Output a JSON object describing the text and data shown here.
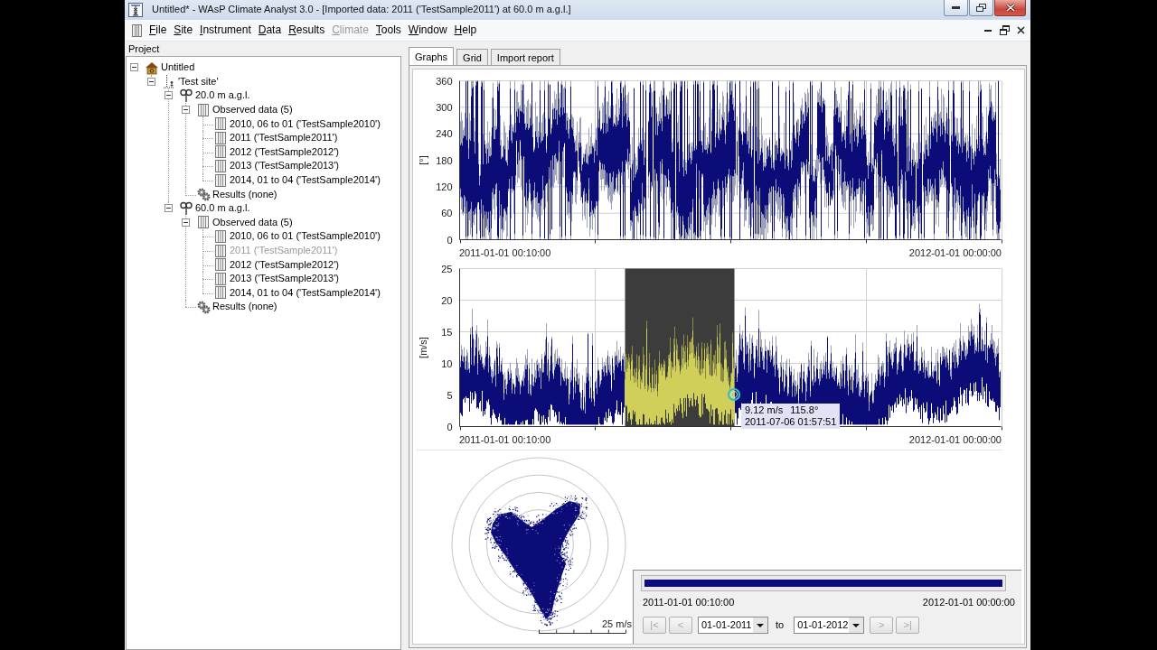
{
  "window": {
    "title": "Untitled* - WAsP Climate Analyst 3.0 - [Imported data: 2011 ('TestSample2011') at 60.0 m a.g.l.]"
  },
  "menu": [
    {
      "label": "File",
      "disabled": false
    },
    {
      "label": "Site",
      "disabled": false
    },
    {
      "label": "Instrument",
      "disabled": false
    },
    {
      "label": "Data",
      "disabled": false
    },
    {
      "label": "Results",
      "disabled": false
    },
    {
      "label": "Climate",
      "disabled": true
    },
    {
      "label": "Tools",
      "disabled": false
    },
    {
      "label": "Window",
      "disabled": false
    },
    {
      "label": "Help",
      "disabled": false
    }
  ],
  "project_pane": {
    "title": "Project",
    "tree": [
      {
        "label": "Untitled",
        "kind": "project",
        "expanded": true,
        "selected": false,
        "children": [
          {
            "label": "'Test site'",
            "kind": "site",
            "expanded": true,
            "selected": false,
            "children": [
              {
                "label": "20.0 m a.g.l.",
                "kind": "height",
                "expanded": true,
                "selected": false,
                "children": [
                  {
                    "label": "Observed data (5)",
                    "kind": "data_group",
                    "expanded": true,
                    "selected": false,
                    "children": [
                      {
                        "label": "2010, 06 to 01 ('TestSample2010')",
                        "kind": "dataset",
                        "selected": false
                      },
                      {
                        "label": "2011 ('TestSample2011')",
                        "kind": "dataset",
                        "selected": false
                      },
                      {
                        "label": "2012 ('TestSample2012')",
                        "kind": "dataset",
                        "selected": false
                      },
                      {
                        "label": "2013 ('TestSample2013')",
                        "kind": "dataset",
                        "selected": false
                      },
                      {
                        "label": "2014, 01 to 04 ('TestSample2014')",
                        "kind": "dataset",
                        "selected": false
                      }
                    ]
                  },
                  {
                    "label": "Results (none)",
                    "kind": "results",
                    "selected": false
                  }
                ]
              },
              {
                "label": "60.0 m a.g.l.",
                "kind": "height",
                "expanded": true,
                "selected": false,
                "children": [
                  {
                    "label": "Observed data (5)",
                    "kind": "data_group",
                    "expanded": true,
                    "selected": false,
                    "children": [
                      {
                        "label": "2010, 06 to 01 ('TestSample2010')",
                        "kind": "dataset",
                        "selected": false
                      },
                      {
                        "label": "2011 ('TestSample2011')",
                        "kind": "dataset",
                        "selected": true
                      },
                      {
                        "label": "2012 ('TestSample2012')",
                        "kind": "dataset",
                        "selected": false
                      },
                      {
                        "label": "2013 ('TestSample2013')",
                        "kind": "dataset",
                        "selected": false
                      },
                      {
                        "label": "2014, 01 to 04 ('TestSample2014')",
                        "kind": "dataset",
                        "selected": false
                      }
                    ]
                  },
                  {
                    "label": "Results (none)",
                    "kind": "results",
                    "selected": false
                  }
                ]
              }
            ]
          }
        ]
      }
    ]
  },
  "tabs": [
    {
      "label": "Graphs",
      "selected": true
    },
    {
      "label": "Grid",
      "selected": false
    },
    {
      "label": "Import report",
      "selected": false
    }
  ],
  "direction_graph": {
    "y_label": "[°]",
    "y_ticks": [
      "360",
      "300",
      "240",
      "180",
      "120",
      "60",
      "0"
    ],
    "x_start": "2011-01-01 00:10:00",
    "x_end": "2012-01-01 00:00:00"
  },
  "speed_graph": {
    "y_label": "[m/s]",
    "y_ticks": [
      "25",
      "20",
      "15",
      "10",
      "5",
      "0"
    ],
    "x_start": "2011-01-01 00:10:00",
    "x_end": "2012-01-01 00:00:00",
    "tooltip": {
      "speed": "9.12 m/s",
      "direction": "115.8°",
      "time": "2011-07-06 01:57:51"
    }
  },
  "wind_scatter": {
    "scale_label": "25 m/s"
  },
  "period_selector": {
    "level": 1,
    "start_label": "2011-01-01 00:10:00",
    "end_label": "2012-01-01 00:00:00",
    "controls": [
      {
        "kind": "button",
        "label": "|<",
        "disabled": true
      },
      {
        "kind": "button",
        "label": "<",
        "disabled": true
      },
      {
        "kind": "dropdown",
        "value": "01-01-2011",
        "disabled": false
      },
      {
        "kind": "text",
        "label": "to",
        "disabled": false
      },
      {
        "kind": "dropdown",
        "value": "01-01-2012",
        "disabled": false
      },
      {
        "kind": "button",
        "label": ">",
        "disabled": true
      },
      {
        "kind": "button",
        "label": ">|",
        "disabled": true
      }
    ]
  }
}
